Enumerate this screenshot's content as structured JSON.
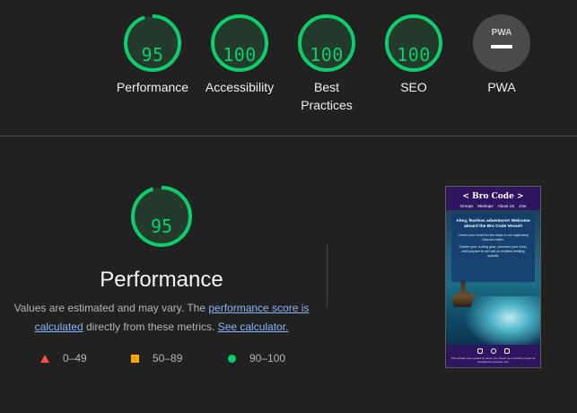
{
  "categories": [
    {
      "label": "Performance",
      "score": "95"
    },
    {
      "label": "Accessibility",
      "score": "100"
    },
    {
      "label": "Best Practices",
      "score": "100"
    },
    {
      "label": "SEO",
      "score": "100"
    },
    {
      "label": "PWA",
      "score": null
    }
  ],
  "main": {
    "score": "95",
    "title": "Performance",
    "desc_prefix": "Values are estimated and may vary. The ",
    "desc_link1": "performance score is calculated",
    "desc_middle": " directly from these metrics. ",
    "desc_link2": "See calculator."
  },
  "legend": {
    "fail": "0–49",
    "average": "50–89",
    "pass": "90–100"
  },
  "colors": {
    "pass": "#0cce6b",
    "average": "#ffa400",
    "fail": "#ff4e42",
    "link": "#8ab4f8"
  },
  "pwa_badge_text": "PWA",
  "preview": {
    "brand": "< Bro Code >",
    "nav": [
      "Groups",
      "Meetups",
      "About Us",
      "Join"
    ],
    "heading": "Ahoy, fearless adventurer! Welcome aboard the Bro Code Vessel!",
    "para1": "Check your email for the keys to our legendary Discord realm.",
    "para2": "Gather your coding gear, summon your crew, and prepare to set sail on endless thrilling quests!",
    "footer_note": "This website was created by Jacob Leo Roster as a portfolio project for educational purposes only."
  }
}
